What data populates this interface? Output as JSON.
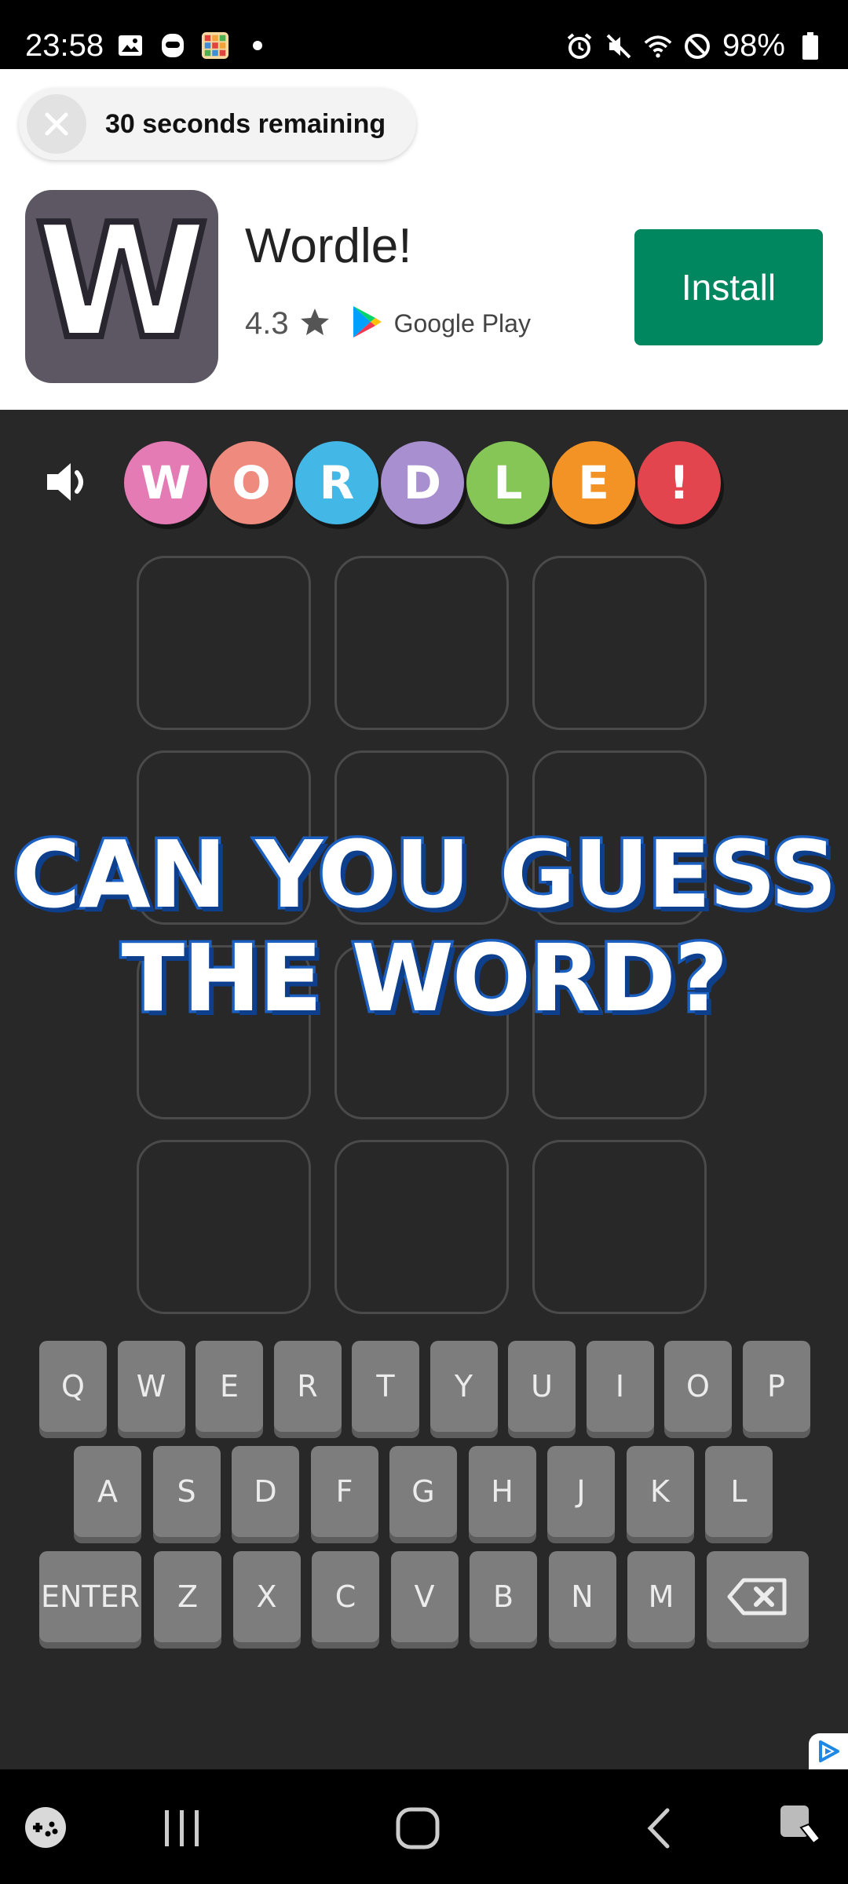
{
  "status_bar": {
    "time": "23:58",
    "battery": "98%",
    "left_icons": [
      "image-icon",
      "face-icon",
      "game-app-icon",
      "dot-icon"
    ],
    "right_icons": [
      "alarm-icon",
      "mute-icon",
      "wifi-icon",
      "blocked-icon",
      "battery-icon"
    ]
  },
  "ad": {
    "countdown_text": "30 seconds remaining",
    "app_icon_letter": "W",
    "app_name": "Wordle!",
    "rating": "4.3",
    "store_label": "Google Play",
    "install_label": "Install",
    "install_color": "#01875f"
  },
  "game": {
    "logo_letters": [
      {
        "char": "W",
        "color": "#e47bb4"
      },
      {
        "char": "O",
        "color": "#ee8a7e"
      },
      {
        "char": "R",
        "color": "#43b8e6"
      },
      {
        "char": "D",
        "color": "#a88fcf"
      },
      {
        "char": "L",
        "color": "#86c657"
      },
      {
        "char": "E",
        "color": "#f39325"
      },
      {
        "char": "!",
        "color": "#e2454e"
      }
    ],
    "headline_line1": "CAN YOU GUESS",
    "headline_line2": "THE WORD?",
    "keyboard": {
      "row1": [
        "Q",
        "W",
        "E",
        "R",
        "T",
        "Y",
        "U",
        "I",
        "O",
        "P"
      ],
      "row2": [
        "A",
        "S",
        "D",
        "F",
        "G",
        "H",
        "J",
        "K",
        "L"
      ],
      "row3": [
        "Z",
        "X",
        "C",
        "V",
        "B",
        "N",
        "M"
      ],
      "enter_label": "ENTER"
    }
  },
  "nav_bar": {
    "items": [
      "game-launcher-icon",
      "recents-icon",
      "home-icon",
      "back-icon",
      "screen-assist-icon"
    ]
  }
}
